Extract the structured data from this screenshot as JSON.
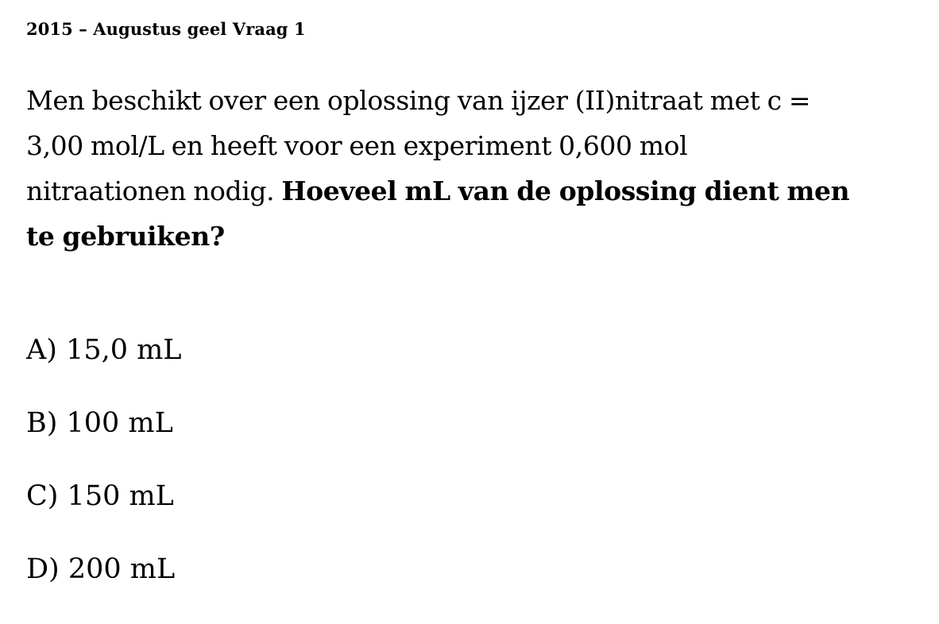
{
  "header": {
    "title": "2015 – Augustus geel Vraag 1"
  },
  "question": {
    "line1": "Men beschikt over een oplossing van ijzer (II)nitraat met c =",
    "line2": "3,00 mol/L en heeft voor een experiment 0,600 mol",
    "line3_normal": "nitraationen nodig. ",
    "line3_bold": "Hoeveel mL van de oplossing dient men",
    "line4_bold": "te gebruiken?"
  },
  "answers": [
    {
      "label": "A) 15,0 mL"
    },
    {
      "label": "B) 100 mL"
    },
    {
      "label": "C) 150 mL"
    },
    {
      "label": "D) 200 mL"
    }
  ]
}
